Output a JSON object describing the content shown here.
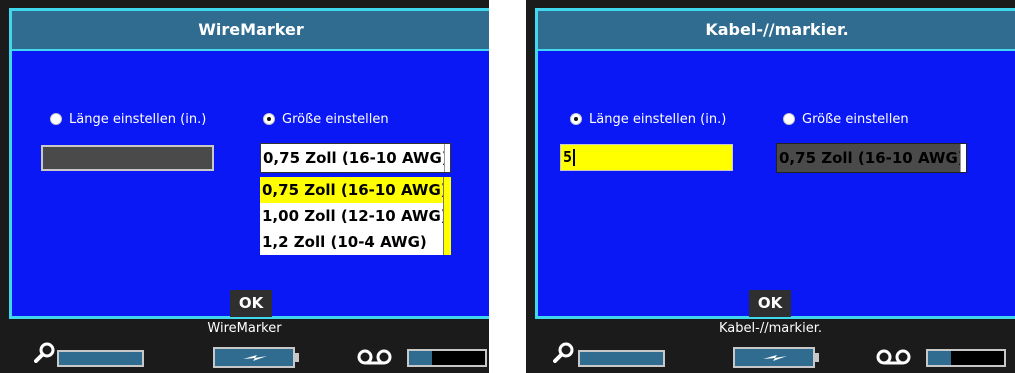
{
  "left": {
    "title": "WireMarker",
    "radio_length": "Länge einstellen  (in.)",
    "radio_size": "Größe einstellen",
    "selected_value": "0,75 Zoll (16-10 AWG)",
    "options": [
      "0,75 Zoll (16-10 AWG)",
      "1,00 Zoll (12-10 AWG)",
      "1,2 Zoll (10-4 AWG)"
    ],
    "ok": "OK",
    "status_title": "WireMarker"
  },
  "right": {
    "title": "Kabel-//markier.",
    "radio_length": "Länge einstellen  (in.)",
    "radio_size": "Größe einstellen",
    "length_value": "5",
    "selected_value": "0,75 Zoll (16-10 AWG)",
    "ok": "OK",
    "status_title": "Kabel-//markier."
  },
  "colors": {
    "dialog_bg": "#0a18f5",
    "title_bg": "#2f6c90",
    "border": "#3fd8ef",
    "highlight": "#ffff00"
  }
}
